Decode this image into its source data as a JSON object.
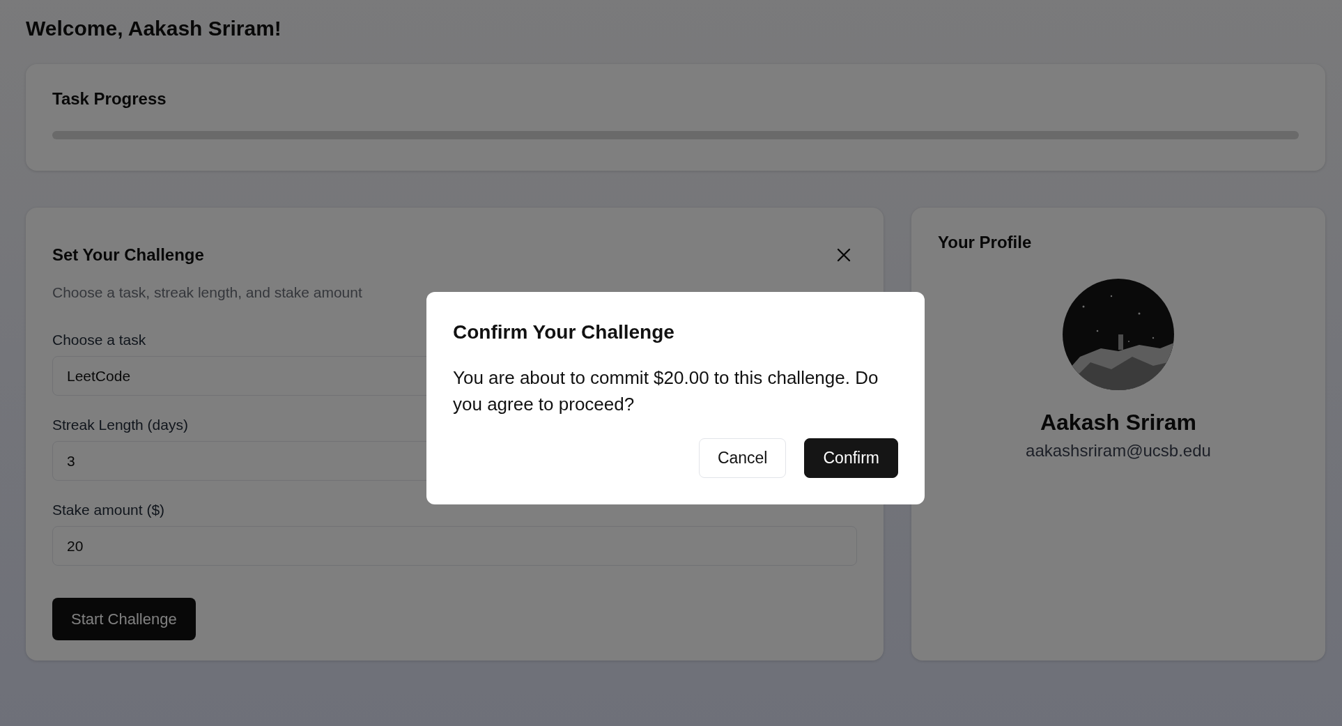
{
  "greeting": "Welcome, Aakash Sriram!",
  "task_progress": {
    "title": "Task Progress",
    "level": 0
  },
  "challenge_form": {
    "title": "Set Your Challenge",
    "subtitle": "Choose a task, streak length, and stake amount",
    "fields": [
      {
        "label": "Choose a task",
        "value": "LeetCode"
      },
      {
        "label": "Streak Length (days)",
        "value": "3"
      },
      {
        "label": "Stake amount ($)",
        "value": "20"
      }
    ],
    "submit": "Start Challenge"
  },
  "profile": {
    "title": "Your Profile",
    "name": "Aakash Sriram",
    "email": "aakashsriram@ucsb.edu"
  },
  "dialog": {
    "title": "Confirm Your Challenge",
    "message": "You are about to commit $20.00 to this challenge. Do you agree to proceed?",
    "buttons": [
      {
        "label": "Cancel",
        "kind": "secondary"
      },
      {
        "label": "Confirm",
        "kind": "primary"
      }
    ]
  }
}
